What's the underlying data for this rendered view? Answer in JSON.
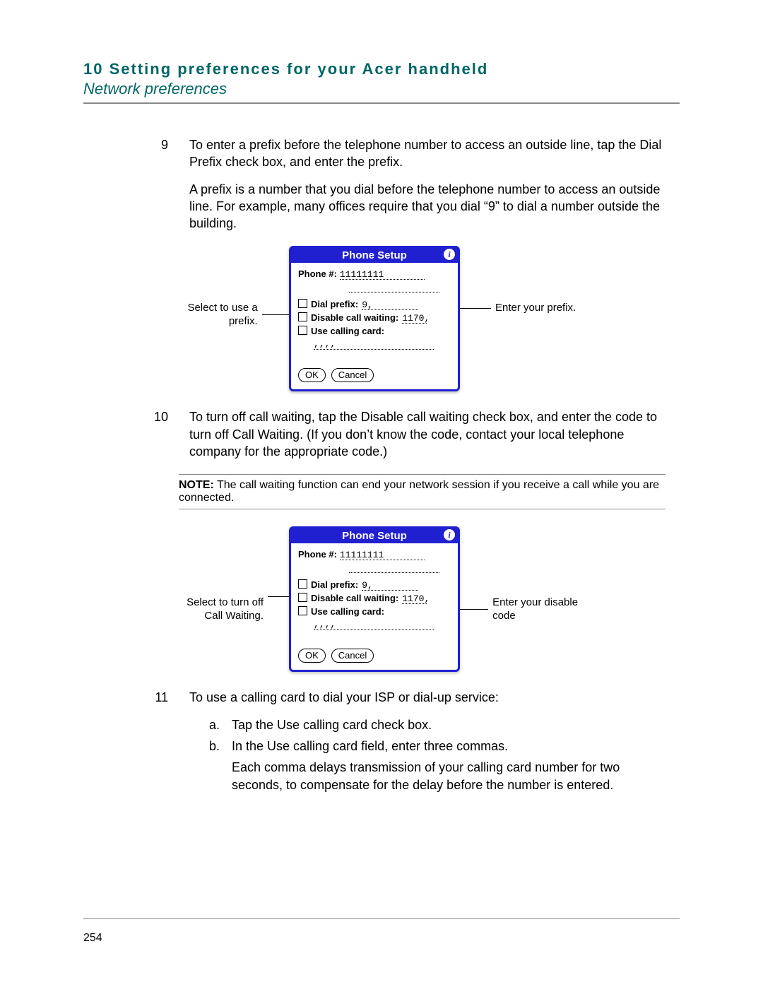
{
  "header": {
    "chapter": "10 Setting preferences for your Acer handheld",
    "section": "Network preferences"
  },
  "steps": {
    "nine": {
      "num": "9",
      "p1": "To enter a prefix before the telephone number to access an outside line, tap the Dial Prefix check box, and enter the prefix.",
      "p2": "A prefix is a number that you dial before the telephone number to access an outside line. For example, many offices require that you dial “9” to dial a number outside the building."
    },
    "ten": {
      "num": "10",
      "p1": "To turn off call waiting, tap the Disable call waiting check box, and enter the code to turn off Call Waiting. (If you don’t know the code, contact your local telephone company for the appropriate code.)"
    },
    "eleven": {
      "num": "11",
      "p1": "To use a calling card to dial your ISP or dial-up service:",
      "a": "Tap the Use calling card check box.",
      "b": "In the Use calling card field, enter three commas.",
      "b_extra": "Each comma delays transmission of your calling card number for two seconds, to compensate for the delay before the number is entered."
    }
  },
  "note": {
    "label": "NOTE:",
    "text": "The call waiting function can end your network session if you receive a call while you are connected."
  },
  "callouts": {
    "fig1_left": "Select to use a prefix.",
    "fig1_right": "Enter your prefix.",
    "fig2_left": "Select to turn off Call Waiting.",
    "fig2_right": "Enter your disable code"
  },
  "dialog": {
    "title": "Phone Setup",
    "phone_label": "Phone #:",
    "phone_value": "11111111",
    "dial_prefix_label": "Dial prefix:",
    "dial_prefix_value": "9,",
    "disable_cw_label": "Disable call waiting:",
    "disable_cw_value": "1170,",
    "calling_card_label": "Use calling card:",
    "calling_card_value": ",,,,",
    "ok": "OK",
    "cancel": "Cancel"
  },
  "page_number": "254"
}
